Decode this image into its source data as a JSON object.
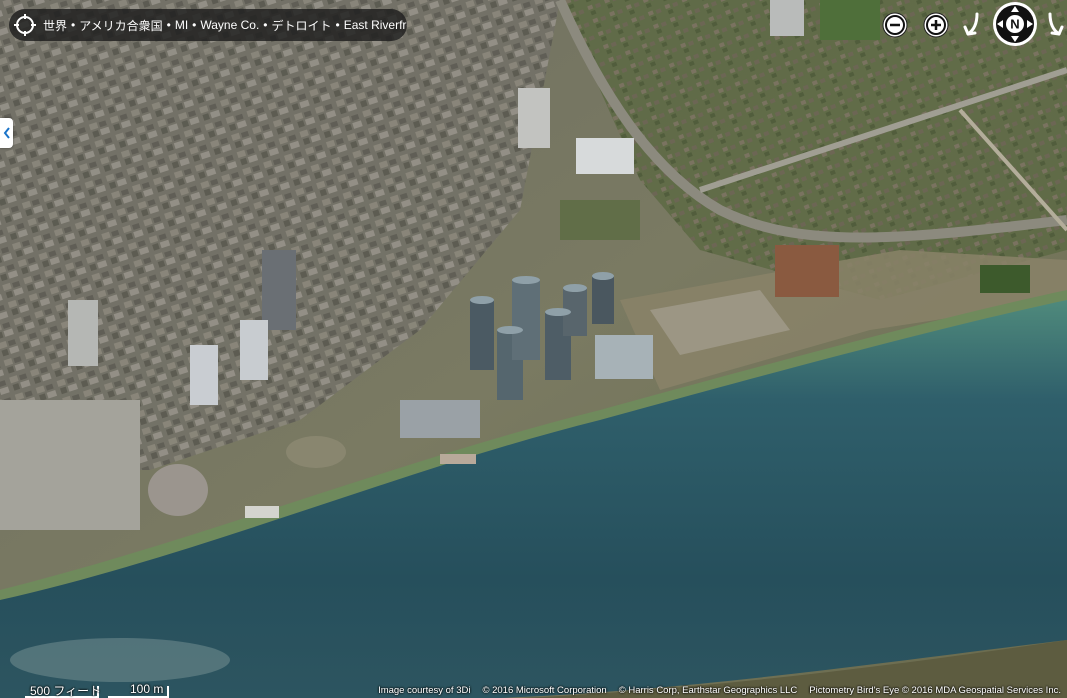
{
  "breadcrumb": {
    "items": [
      "世界",
      "アメリカ合衆国",
      "MI",
      "Wayne Co.",
      "デトロイト",
      "East Riverfront"
    ],
    "separator": "•"
  },
  "controls": {
    "zoom_out_icon": "minus-circle-icon",
    "zoom_in_icon": "plus-circle-icon",
    "rotate_left_icon": "arrow-down-left-icon",
    "compass_icon": "compass-icon",
    "compass_label": "N",
    "rotate_right_icon": "arrow-down-right-icon"
  },
  "scale": {
    "imperial_label": "500 フィート",
    "metric_label": "100 m"
  },
  "attribution": {
    "items": [
      "Image courtesy of 3Di",
      "© 2016 Microsoft Corporation",
      "© Harris Corp, Earthstar Geographics LLC",
      "Pictometry Bird's Eye © 2016 MDA Geospatial Services Inc."
    ]
  },
  "colors": {
    "river": "#2c5a66",
    "land": "#6b6d55",
    "ui_dark": "#1e1e1e",
    "ui_white": "#ffffff"
  }
}
